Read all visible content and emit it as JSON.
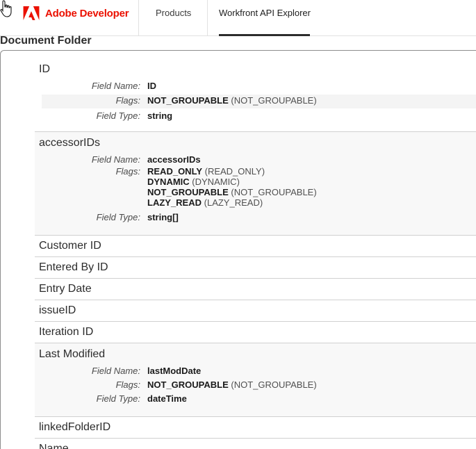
{
  "nav": {
    "brand": "Adobe Developer",
    "items": [
      "Products",
      "Workfront API Explorer"
    ],
    "active": "Workfront API Explorer"
  },
  "page": {
    "title": "Document Folder"
  },
  "labels": {
    "field_name": "Field Name:",
    "flags": "Flags:",
    "field_type": "Field Type:"
  },
  "fields": {
    "id": {
      "name": "ID",
      "field_name": "ID",
      "flags": [
        {
          "flag": "NOT_GROUPABLE",
          "desc": "(NOT_GROUPABLE)"
        }
      ],
      "field_type": "string"
    },
    "accessor": {
      "name": "accessorIDs",
      "field_name": "accessorIDs",
      "flags": [
        {
          "flag": "READ_ONLY",
          "desc": "(READ_ONLY)"
        },
        {
          "flag": "DYNAMIC",
          "desc": "(DYNAMIC)"
        },
        {
          "flag": "NOT_GROUPABLE",
          "desc": "(NOT_GROUPABLE)"
        },
        {
          "flag": "LAZY_READ",
          "desc": "(LAZY_READ)"
        }
      ],
      "field_type": "string[]"
    },
    "collapsed1": [
      "Customer ID",
      "Entered By ID",
      "Entry Date",
      "issueID",
      "Iteration ID"
    ],
    "lastmod": {
      "name": "Last Modified",
      "field_name": "lastModDate",
      "flags": [
        {
          "flag": "NOT_GROUPABLE",
          "desc": "(NOT_GROUPABLE)"
        }
      ],
      "field_type": "dateTime"
    },
    "collapsed2": [
      "linkedFolderID",
      "Name"
    ]
  },
  "colors": {
    "brand": "#eb1000",
    "text": "#2c2c2c",
    "divider": "#d0d0d0"
  }
}
